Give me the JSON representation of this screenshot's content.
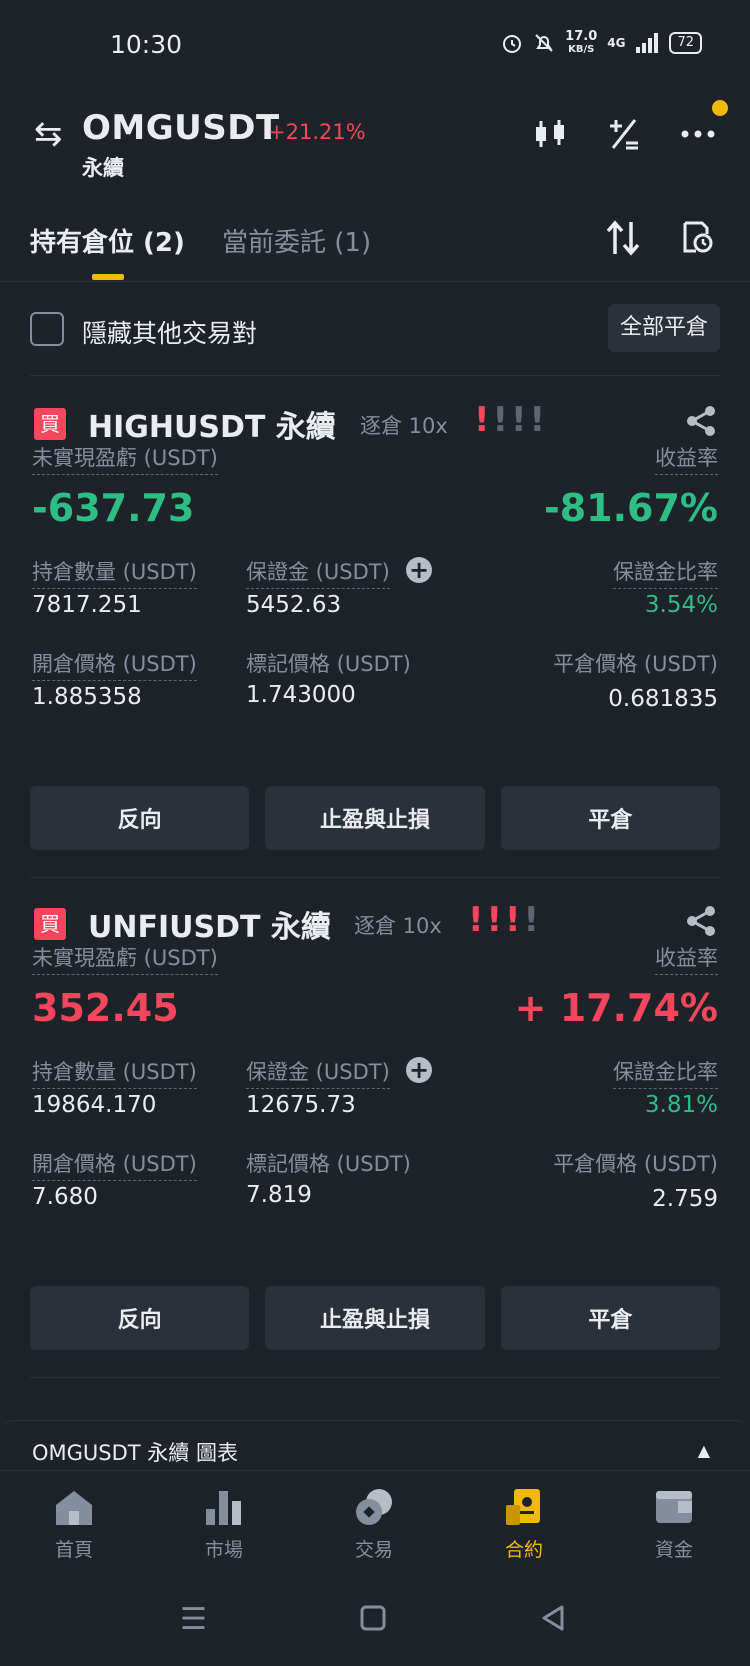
{
  "status": {
    "time": "10:30",
    "speed_value": "17.0",
    "speed_unit": "KB/S",
    "network": "4G",
    "battery": "72"
  },
  "header": {
    "symbol": "OMGUSDT",
    "change": "+21.21%",
    "subtitle": "永續"
  },
  "tabs": [
    {
      "label": "持有倉位 (2)"
    },
    {
      "label": "當前委託 (1)"
    }
  ],
  "filter": {
    "hide_label": "隱藏其他交易對",
    "close_all": "全部平倉"
  },
  "positions": [
    {
      "side": "買",
      "symbol": "HIGHUSDT 永續",
      "margin": "逐倉 10x",
      "risk_marks": "!!!!",
      "pnl_label": "未實現盈虧 (USDT)",
      "pnl": "-637.73",
      "roe_label": "收益率",
      "roe": "-81.67%",
      "size_label": "持倉數量 (USDT)",
      "size": "7817.251",
      "margin_label": "保證金 (USDT)",
      "margin_value": "5452.63",
      "ratio_label": "保證金比率",
      "ratio": "3.54%",
      "entry_label": "開倉價格 (USDT)",
      "entry": "1.885358",
      "mark_label": "標記價格 (USDT)",
      "mark": "1.743000",
      "liq_label": "平倉價格 (USDT)",
      "liq": "0.681835",
      "btn_reverse": "反向",
      "btn_tpsl": "止盈與止損",
      "btn_close": "平倉"
    },
    {
      "side": "買",
      "symbol": "UNFIUSDT 永續",
      "margin": "逐倉 10x",
      "risk_marks": "!!!!",
      "pnl_label": "未實現盈虧 (USDT)",
      "pnl": "352.45",
      "roe_label": "收益率",
      "roe": "+ 17.74%",
      "size_label": "持倉數量 (USDT)",
      "size": "19864.170",
      "margin_label": "保證金 (USDT)",
      "margin_value": "12675.73",
      "ratio_label": "保證金比率",
      "ratio": "3.81%",
      "entry_label": "開倉價格 (USDT)",
      "entry": "7.680",
      "mark_label": "標記價格 (USDT)",
      "mark": "7.819",
      "liq_label": "平倉價格 (USDT)",
      "liq": "2.759",
      "btn_reverse": "反向",
      "btn_tpsl": "止盈與止損",
      "btn_close": "平倉"
    }
  ],
  "chart_bar": {
    "label": "OMGUSDT 永續  圖表"
  },
  "nav": [
    {
      "label": "首頁",
      "icon": "home-icon"
    },
    {
      "label": "市場",
      "icon": "market-icon"
    },
    {
      "label": "交易",
      "icon": "trade-icon"
    },
    {
      "label": "合約",
      "icon": "futures-icon"
    },
    {
      "label": "資金",
      "icon": "wallet-icon"
    }
  ],
  "colors": {
    "accent": "#f0b90b",
    "up": "#2ebd85",
    "down": "#f6465d",
    "bg": "#1e2329"
  }
}
